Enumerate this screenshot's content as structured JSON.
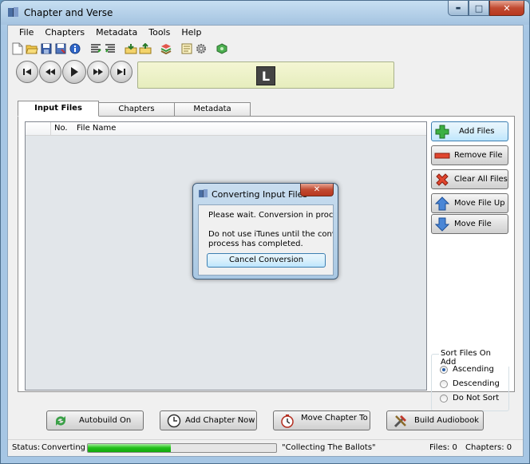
{
  "window": {
    "title": "Chapter and Verse",
    "minimize_glyph": "▬",
    "maximize_glyph": "□",
    "close_glyph": "✕"
  },
  "menu": [
    "File",
    "Chapters",
    "Metadata",
    "Tools",
    "Help"
  ],
  "toolbar_icons": [
    "new-icon",
    "open-icon",
    "save-icon",
    "save-as-icon",
    "info-icon",
    "align-left-icon",
    "align-right-icon",
    "import-icon",
    "export-icon",
    "layers-icon",
    "chapter-list-icon",
    "settings-icon",
    "globe-icon"
  ],
  "transport": {
    "buttons": [
      "skip-back-icon",
      "rewind-icon",
      "play-icon",
      "fast-forward-icon",
      "skip-forward-icon"
    ],
    "display_badge": "L"
  },
  "tabs": [
    {
      "label": "Input Files",
      "active": true
    },
    {
      "label": "Chapters",
      "active": false
    },
    {
      "label": "Metadata",
      "active": false
    }
  ],
  "file_list": {
    "columns": [
      "No.",
      "File Name"
    ],
    "rows": []
  },
  "side_buttons": {
    "add_files": "Add Files",
    "remove_file": "Remove File",
    "clear_all_files": "Clear All Files",
    "move_file_up": "Move File Up",
    "move_file_down": "Move File"
  },
  "sort": {
    "legend": "Sort Files On Add",
    "options": [
      {
        "label": "Ascending",
        "selected": true
      },
      {
        "label": "Descending",
        "selected": false
      },
      {
        "label": "Do Not Sort",
        "selected": false
      }
    ]
  },
  "bottom_buttons": {
    "autobuild": "Autobuild On",
    "add_chapter": "Add Chapter Now",
    "move_chapter": "Move Chapter To",
    "build": "Build Audiobook"
  },
  "status": {
    "label": "Status:",
    "value": "Converting",
    "progress_percent": 44,
    "message": "\"Collecting The Ballots\"",
    "files": "Files: 0",
    "chapters": "Chapters: 0"
  },
  "dialog": {
    "title": "Converting Input Files",
    "close_glyph": "✕",
    "line1": "Please wait.  Conversion in process",
    "line2": "Do not use iTunes until the conversic",
    "line3": "process has completed.",
    "button": "Cancel Conversion"
  },
  "colors": {
    "window_frame": "#a6c6e4",
    "progress": "#25c11d",
    "close_button": "#c14a31"
  }
}
